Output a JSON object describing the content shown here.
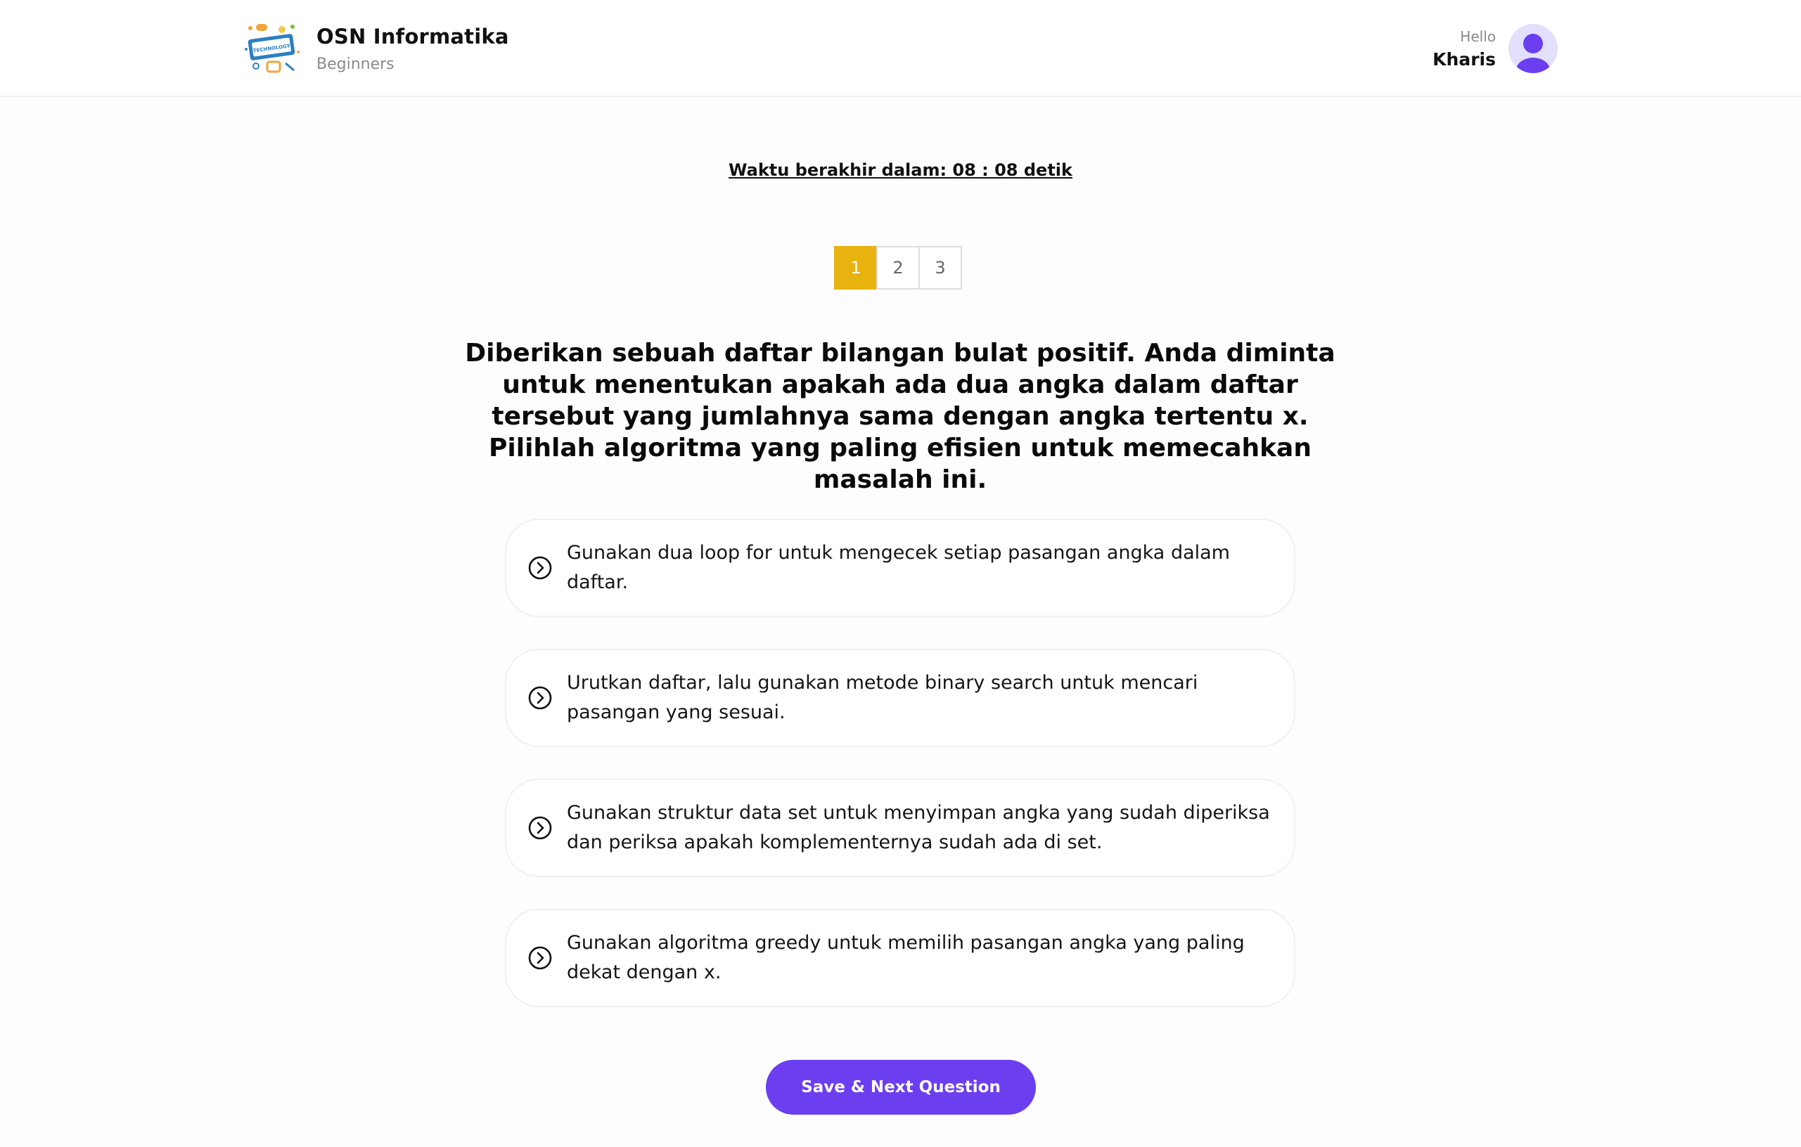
{
  "header": {
    "app_title": "OSN Informatika",
    "app_subtitle": "Beginners",
    "logo_text": "TECHNOLOGY",
    "greeting": "Hello",
    "user_name": "Kharis"
  },
  "quiz": {
    "timer_text": "Waktu berakhir dalam: 08 : 08 detik",
    "pages": [
      "1",
      "2",
      "3"
    ],
    "active_page": "1",
    "question": "Diberikan sebuah daftar bilangan bulat positif. Anda diminta untuk menentukan apakah ada dua angka dalam daftar tersebut yang jumlahnya sama dengan angka tertentu x. Pilihlah algoritma yang paling efisien untuk memecahkan masalah ini.",
    "options": [
      "Gunakan dua loop for untuk mengecek setiap pasangan angka dalam daftar.",
      "Urutkan daftar, lalu gunakan metode binary search untuk mencari pasangan yang sesuai.",
      "Gunakan struktur data set untuk menyimpan angka yang sudah diperiksa dan periksa apakah komplementernya sudah ada di set.",
      "Gunakan algoritma greedy untuk memilih pasangan angka yang paling dekat dengan x."
    ],
    "option_icon": "chevron-circle-right-icon",
    "submit_label": "Save & Next Question"
  },
  "colors": {
    "accent": "#6b3ef0",
    "active_page": "#e8b20f",
    "avatar_bg": "#e2e0fb"
  }
}
